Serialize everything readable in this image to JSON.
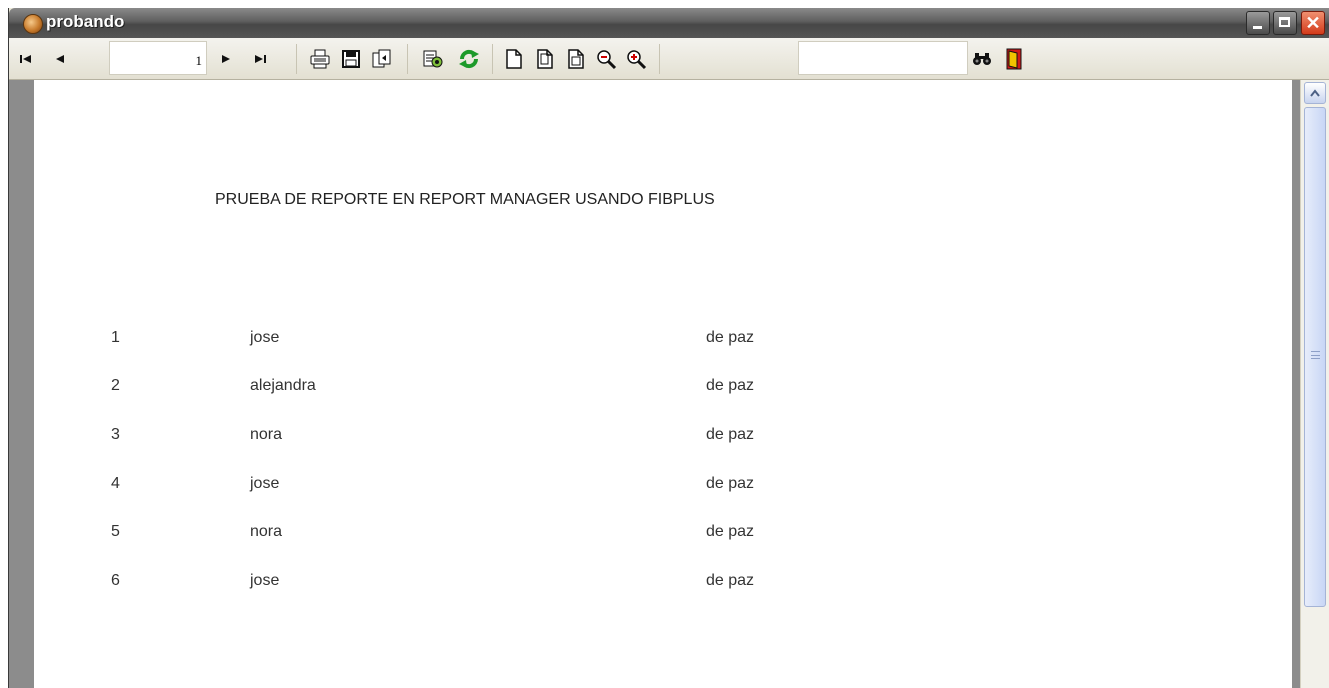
{
  "window": {
    "title": "probando",
    "min_glyph": "",
    "close_glyph": "✕"
  },
  "toolbar": {
    "first_glyph": "⏮",
    "prev_glyph": "◄",
    "page_value": "1",
    "next_glyph": "►",
    "last_glyph": "⏭",
    "search_value": "",
    "icons": [
      "first-page-icon",
      "previous-page-icon",
      "next-page-icon",
      "last-page-icon",
      "print-icon",
      "save-icon",
      "export-icon",
      "parameters-icon",
      "refresh-icon",
      "page-width-icon",
      "page-height-icon",
      "full-page-icon",
      "zoom-out-icon",
      "zoom-in-icon",
      "find-icon",
      "exit-icon"
    ]
  },
  "report": {
    "title": "PRUEBA DE REPORTE EN REPORT MANAGER USANDO FIBPLUS",
    "rows": [
      {
        "num": "1",
        "name": "jose",
        "last": "de paz"
      },
      {
        "num": "2",
        "name": "alejandra",
        "last": "de paz"
      },
      {
        "num": "3",
        "name": "nora",
        "last": "de paz"
      },
      {
        "num": "4",
        "name": "jose",
        "last": "de paz"
      },
      {
        "num": "5",
        "name": "nora",
        "last": "de paz"
      },
      {
        "num": "6",
        "name": "jose",
        "last": "de paz"
      }
    ]
  },
  "colors": {
    "titlebar": "#5e5e5e",
    "close_button": "#d33a1a",
    "refresh_green": "#1d9a2a",
    "exit_red": "#d01818",
    "exit_yellow": "#f2c200"
  }
}
